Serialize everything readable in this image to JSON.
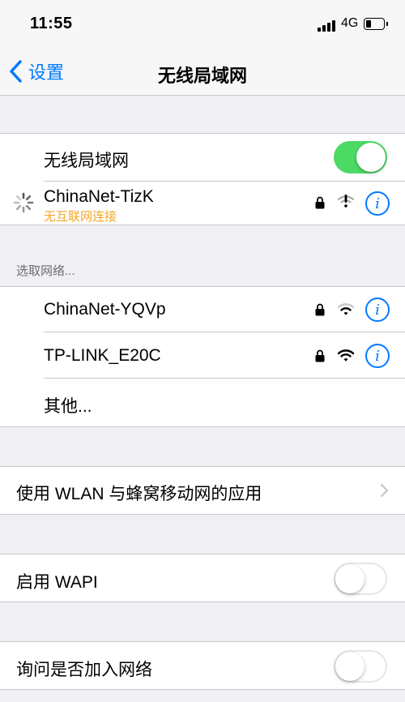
{
  "status_bar": {
    "time": "11:55",
    "network": "4G",
    "icons": [
      "cellular-signal-icon",
      "battery-icon"
    ]
  },
  "nav": {
    "back_label": "设置",
    "title": "无线局域网"
  },
  "wlan": {
    "toggle_label": "无线局域网",
    "toggle_on": true,
    "connected_network": {
      "name": "ChinaNet-TizK",
      "status": "无互联网连接",
      "icons": [
        "spinner-icon",
        "lock-icon",
        "wifi-warning-icon",
        "info-icon"
      ]
    }
  },
  "choose_network": {
    "header": "选取网络...",
    "networks": [
      {
        "name": "ChinaNet-YQVp",
        "icons": [
          "lock-icon",
          "wifi-icon",
          "info-icon"
        ]
      },
      {
        "name": "TP-LINK_E20C",
        "icons": [
          "lock-icon",
          "wifi-icon",
          "info-icon"
        ]
      }
    ],
    "other_label": "其他..."
  },
  "apps_using_wlan": {
    "label": "使用 WLAN 与蜂窝移动网的应用"
  },
  "wapi": {
    "label": "启用 WAPI",
    "on": false
  },
  "ask_to_join": {
    "label": "询问是否加入网络",
    "on": false
  },
  "colors": {
    "accent": "#007aff",
    "toggle_on": "#4cd964",
    "warning_text": "#f5a623",
    "background": "#efeff4"
  }
}
